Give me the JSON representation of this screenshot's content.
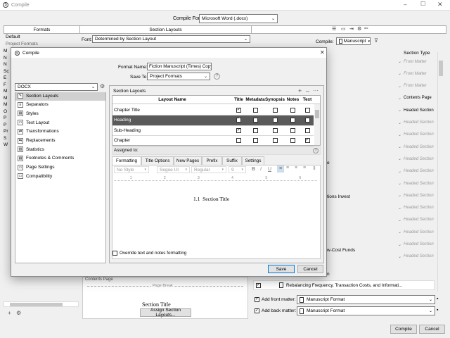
{
  "window": {
    "title": "Compile",
    "icon": "scrivener-icon"
  },
  "compile_for": {
    "label": "Compile For:",
    "value": "Microsoft Word (.docx)"
  },
  "bg_columns": {
    "formats": "Formats",
    "section_layouts": "Section Layouts"
  },
  "bg_left": {
    "items": [
      "Default",
      "Project Formats"
    ]
  },
  "bg_font": {
    "label": "Font:",
    "value": "Determined by Section Layout"
  },
  "bg_compile": {
    "label": "Compile:",
    "value": "Manuscript"
  },
  "bg_section_type_header": "Section Type",
  "section_types": [
    "Front Matter",
    "Front Matter",
    "Front Matter",
    "Contents Page",
    "Headed Section",
    "Headed Section",
    "Headed Section",
    "Headed Section",
    "Headed Section",
    "Headed Section",
    "Headed Section",
    "Headed Section",
    "Headed Section",
    "Headed Section",
    "Headed Section",
    "Headed Section",
    "Headed Section"
  ],
  "bg_fragments": [
    "e",
    "tions Invest",
    "w-Cost Funds",
    "n"
  ],
  "bg_contents_label": "Contents Page",
  "bg_page_break": "Page Break",
  "bg_section_title": "Section Title",
  "bg_assign_btn": "Assign Section Layouts...",
  "bg_rebalancing": "Rebalancing Frequency, Transaction Costs, and Informati...",
  "front_matter": {
    "label": "Add front matter:",
    "value": "Manuscript Format"
  },
  "back_matter": {
    "label": "Add back matter:",
    "value": "Manuscript Format"
  },
  "bottom_buttons": {
    "compile": "Compile",
    "cancel": "Cancel"
  },
  "dialog": {
    "title": "Compile",
    "format_name_label": "Format Name:",
    "format_name_value": "Fiction Manuscript (Times) Copy",
    "save_to_label": "Save To:",
    "save_to_value": "Project Formats",
    "help": "?",
    "format_select": "DOCX",
    "nav": [
      "Section Layouts",
      "Separators",
      "Styles",
      "Text Layout",
      "Transformations",
      "Replacements",
      "Statistics",
      "Footnotes & Comments",
      "Page Settings",
      "Compatibility"
    ],
    "section_layouts_title": "Section Layouts",
    "table_headers": [
      "Layout Name",
      "Title",
      "Metadata",
      "Synopsis",
      "Notes",
      "Text"
    ],
    "table_rows": [
      {
        "name": "Chapter Title",
        "checks": [
          true,
          false,
          false,
          false,
          false
        ]
      },
      {
        "name": "Heading",
        "checks": [
          true,
          false,
          false,
          false,
          false
        ],
        "selected": true
      },
      {
        "name": "Sub-Heading",
        "checks": [
          true,
          false,
          false,
          false,
          false
        ]
      },
      {
        "name": "Chapter",
        "checks": [
          false,
          false,
          false,
          false,
          true
        ]
      }
    ],
    "assigned_to": "Assigned to:",
    "tabs": [
      "Formatting",
      "Title Options",
      "New Pages",
      "Prefix",
      "Suffix",
      "Settings"
    ],
    "style_select": "No Style",
    "font_select": "Segoe UI",
    "weight_select": "Regular",
    "size_select": "9",
    "format_buttons": [
      "B",
      "I",
      "U"
    ],
    "preview_text": "1.1  Section Title",
    "override_label": "Override text and notes formatting",
    "save": "Save",
    "cancel": "Cancel"
  }
}
